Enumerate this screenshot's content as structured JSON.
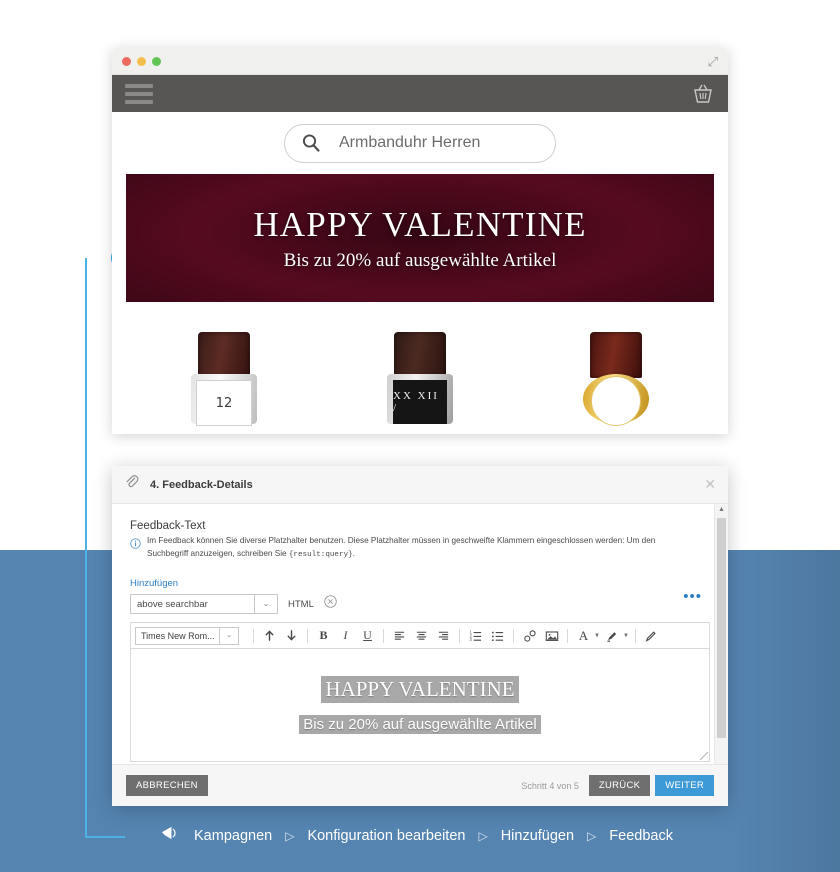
{
  "browser": {
    "titlebar": {
      "close_dot": "close",
      "minimize_dot": "minimize",
      "maximize_dot": "maximize",
      "expand_glyph": "⤢"
    },
    "navbar": {
      "menu_icon": "hamburger-icon",
      "cart_icon": "shopping-basket-icon"
    },
    "search": {
      "icon": "search-icon",
      "value": "Armbanduhr Herren"
    },
    "banner": {
      "headline": "HAPPY VALENTINE",
      "subline": "Bis zu 20% auf ausgewählte Artikel"
    },
    "products": [
      {
        "name": "watch-silver-square",
        "dial": "12"
      },
      {
        "name": "watch-steel-black-dial",
        "dial": "XX XII /"
      },
      {
        "name": "watch-gold-round",
        "dial": ""
      }
    ]
  },
  "dialog": {
    "header": {
      "icon": "paperclip-icon",
      "title": "4. Feedback-Details",
      "close_glyph": "✕"
    },
    "field_label": "Feedback-Text",
    "info": {
      "icon": "info-icon",
      "text_before": "Im Feedback können Sie diverse Platzhalter benutzen. Diese Platzhalter müssen in geschweifte Klammern eingeschlossen werden: Um den Suchbegriff anzuzeigen, schreiben Sie ",
      "placeholder_token": "{result:query}",
      "text_after": "."
    },
    "kebab_menu": "•••",
    "add_link": "Hinzufügen",
    "placement": {
      "value": "above searchbar",
      "caret": "⌄"
    },
    "format_label": "HTML",
    "remove_format_icon": "remove-circle-icon",
    "editor": {
      "font": "Times New Rom...",
      "font_caret": "⌄",
      "tools": [
        {
          "name": "move-up-button",
          "glyph": "↑"
        },
        {
          "name": "move-down-button",
          "glyph": "↓"
        },
        {
          "name": "bold-button",
          "glyph": "B"
        },
        {
          "name": "italic-button",
          "glyph": "I"
        },
        {
          "name": "underline-button",
          "glyph": "U"
        },
        {
          "name": "align-left-button",
          "glyph": "≡"
        },
        {
          "name": "align-center-button",
          "glyph": "≡"
        },
        {
          "name": "align-right-button",
          "glyph": "≡"
        },
        {
          "name": "ordered-list-button",
          "glyph": "≔"
        },
        {
          "name": "bullet-list-button",
          "glyph": "≡"
        },
        {
          "name": "insert-link-button",
          "glyph": "🔗"
        },
        {
          "name": "insert-image-button",
          "glyph": "🖼"
        },
        {
          "name": "font-color-button",
          "glyph": "A"
        },
        {
          "name": "highlight-button",
          "glyph": "🖌"
        },
        {
          "name": "format-paint-button",
          "glyph": "✏"
        }
      ],
      "content_headline": "HAPPY VALENTINE",
      "content_subline": "Bis zu 20% auf ausgewählte Artikel"
    },
    "footer": {
      "cancel_label": "ABBRECHEN",
      "step_text": "Schritt 4 von 5",
      "back_label": "ZURÜCK",
      "next_label": "WEITER"
    }
  },
  "breadcrumb": {
    "icon": "megaphone-icon",
    "separator": "▷",
    "items": [
      {
        "label": "Kampagnen"
      },
      {
        "label": "Konfiguration bearbeiten"
      },
      {
        "label": "Hinzufügen"
      },
      {
        "label": "Feedback"
      }
    ]
  },
  "colors": {
    "band_blue": "#5584b1",
    "accent_blue": "#31ade3",
    "link_blue": "#2b7fc4",
    "primary_button": "#3d9ad6",
    "navbar_dark": "#585655"
  }
}
